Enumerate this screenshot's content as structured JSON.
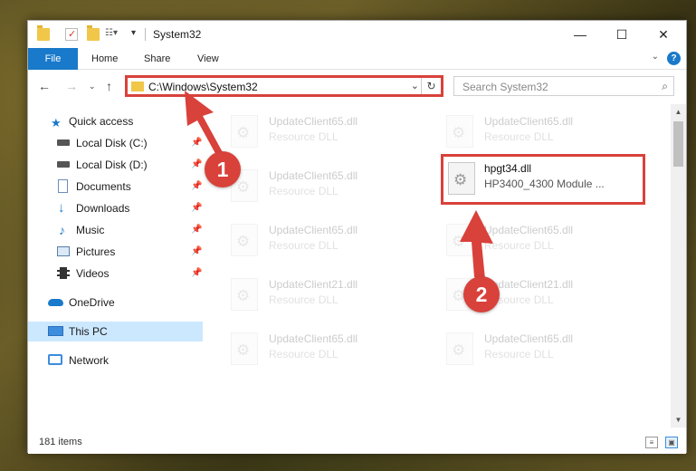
{
  "window": {
    "title": "System32"
  },
  "title_buttons": {
    "minimize": "—",
    "maximize": "☐",
    "close": "✕"
  },
  "ribbon": {
    "file": "File",
    "tabs": [
      "Home",
      "Share",
      "View"
    ],
    "help": "?"
  },
  "address_bar": {
    "path": "C:\\Windows\\System32"
  },
  "search": {
    "placeholder": "Search System32"
  },
  "sidebar": {
    "items": [
      {
        "label": "Quick access",
        "icon": "star-icon"
      },
      {
        "label": "Local Disk (C:)",
        "icon": "drive-icon",
        "pinned": true
      },
      {
        "label": "Local Disk (D:)",
        "icon": "drive-icon",
        "pinned": true
      },
      {
        "label": "Documents",
        "icon": "documents-icon",
        "pinned": true
      },
      {
        "label": "Downloads",
        "icon": "downloads-icon",
        "pinned": true
      },
      {
        "label": "Music",
        "icon": "music-icon",
        "pinned": true
      },
      {
        "label": "Pictures",
        "icon": "pictures-icon",
        "pinned": true
      },
      {
        "label": "Videos",
        "icon": "videos-icon",
        "pinned": true
      },
      {
        "label": "OneDrive",
        "icon": "cloud-icon"
      },
      {
        "label": "This PC",
        "icon": "computer-icon",
        "selected": true
      },
      {
        "label": "Network",
        "icon": "network-icon"
      }
    ]
  },
  "files": [
    {
      "name": "UpdateClient65.dll",
      "desc": "Resource DLL"
    },
    {
      "name": "UpdateClient65.dll",
      "desc": "Resource DLL"
    },
    {
      "name": "UpdateClient65.dll",
      "desc": "Resource DLL"
    },
    {
      "name": "hpgt34.dll",
      "desc": "HP3400_4300 Module ...",
      "highlighted": true
    },
    {
      "name": "UpdateClient65.dll",
      "desc": "Resource DLL"
    },
    {
      "name": "UpdateClient65.dll",
      "desc": "Resource DLL"
    },
    {
      "name": "UpdateClient21.dll",
      "desc": "Resource DLL"
    },
    {
      "name": "UpdateClient21.dll",
      "desc": "Resource DLL"
    },
    {
      "name": "UpdateClient65.dll",
      "desc": "Resource DLL"
    },
    {
      "name": "UpdateClient65.dll",
      "desc": "Resource DLL"
    }
  ],
  "status": {
    "item_count": "181 items"
  },
  "annotations": {
    "step1": "1",
    "step2": "2"
  },
  "colors": {
    "accent": "#1979ca",
    "highlight": "#d9413b",
    "selected_bg": "#cce8ff"
  }
}
